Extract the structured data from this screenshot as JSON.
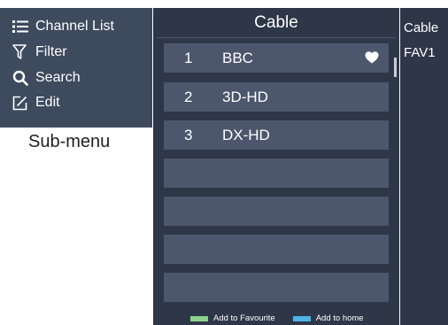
{
  "submenu": {
    "items": [
      {
        "label": "Channel List",
        "icon": "list-icon"
      },
      {
        "label": "Filter",
        "icon": "filter-icon"
      },
      {
        "label": "Search",
        "icon": "search-icon"
      },
      {
        "label": "Edit",
        "icon": "edit-icon"
      }
    ],
    "caption": "Sub-menu"
  },
  "channel_list": {
    "title": "Cable",
    "channels": [
      {
        "number": "1",
        "name": "BBC",
        "favourite": true
      },
      {
        "number": "2",
        "name": "3D-HD",
        "favourite": false
      },
      {
        "number": "3",
        "name": "DX-HD",
        "favourite": false
      }
    ],
    "empty_rows": 4,
    "legend": [
      {
        "label": "Add to Favourite",
        "color": "#8ed28e"
      },
      {
        "label": "Add to home",
        "color": "#4fb3e8"
      }
    ]
  },
  "right_panel": {
    "items": [
      "Cable",
      "FAV1"
    ]
  },
  "colors": {
    "panel_bg": "#2d3748",
    "submenu_bg": "#3e4a5e",
    "row_bg": "#4c576d"
  }
}
